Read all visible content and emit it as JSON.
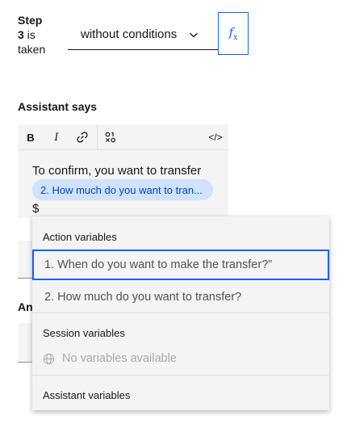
{
  "step": {
    "word": "Step",
    "number": "3",
    "suffix_is": " is",
    "suffix_taken": "taken"
  },
  "condition_select": {
    "value": "without conditions"
  },
  "fx_button": {
    "label": "f",
    "sub": "x"
  },
  "assistant_says": {
    "title": "Assistant says",
    "toolbar": {
      "bold": "B",
      "italic": "I",
      "code": "</>"
    },
    "text": "To confirm, you want to transfer",
    "variable_chip": "2. How much do you want to tran...",
    "dollar": "$"
  },
  "obscured_label": "An",
  "variables_menu": {
    "action_heading": "Action variables",
    "action_items": [
      "1. When do you want to make the transfer?”",
      "2. How much do you want to transfer?"
    ],
    "session_heading": "Session variables",
    "session_empty": "No variables available",
    "assistant_heading": "Assistant variables"
  },
  "colors": {
    "accent": "#0f62fe",
    "chip_bg": "#d0e2ff",
    "chip_text": "#0043ce",
    "menu_bg": "#f4f4f4"
  }
}
